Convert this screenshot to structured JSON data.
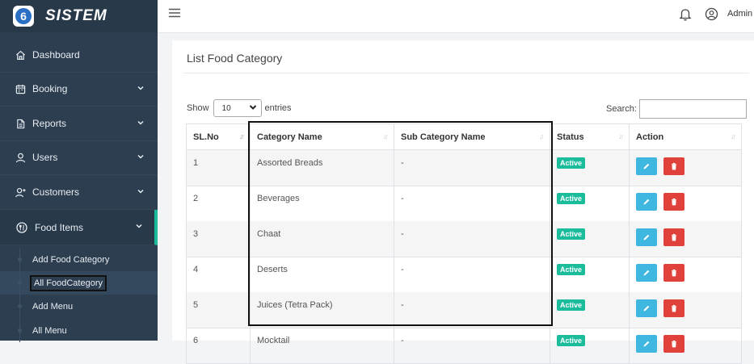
{
  "brand": {
    "logo_letter": "6",
    "name": "SISTEM"
  },
  "sidebar": {
    "items": [
      {
        "label": "Dashboard",
        "icon": "home-icon"
      },
      {
        "label": "Booking",
        "icon": "calendar-icon"
      },
      {
        "label": "Reports",
        "icon": "document-icon"
      },
      {
        "label": "Users",
        "icon": "user-icon"
      },
      {
        "label": "Customers",
        "icon": "user-plus-icon"
      },
      {
        "label": "Food Items",
        "icon": "food-icon"
      }
    ],
    "submenu": [
      {
        "label": "Add Food Category"
      },
      {
        "label": "All FoodCategory"
      },
      {
        "label": "Add Menu"
      },
      {
        "label": "All Menu"
      }
    ]
  },
  "topbar": {
    "user_label": "Admin"
  },
  "page": {
    "title": "List Food Category",
    "show_label": "Show",
    "page_size": "10",
    "entries_label": "entries",
    "search_label": "Search:"
  },
  "table": {
    "columns": [
      "SL.No",
      "Category Name",
      "Sub Category Name",
      "Status",
      "Action"
    ],
    "rows": [
      {
        "sl": "1",
        "category": "Assorted Breads",
        "sub": "-",
        "status": "Active"
      },
      {
        "sl": "2",
        "category": "Beverages",
        "sub": "-",
        "status": "Active"
      },
      {
        "sl": "3",
        "category": "Chaat",
        "sub": "-",
        "status": "Active"
      },
      {
        "sl": "4",
        "category": "Deserts",
        "sub": "-",
        "status": "Active"
      },
      {
        "sl": "5",
        "category": "Juices (Tetra Pack)",
        "sub": "-",
        "status": "Active"
      },
      {
        "sl": "6",
        "category": "Mocktail",
        "sub": "-",
        "status": "Active"
      }
    ]
  },
  "colors": {
    "sidebar": "#2c3e50",
    "accent": "#1abc9c",
    "edit": "#3fb7e0",
    "delete": "#e0413a"
  }
}
